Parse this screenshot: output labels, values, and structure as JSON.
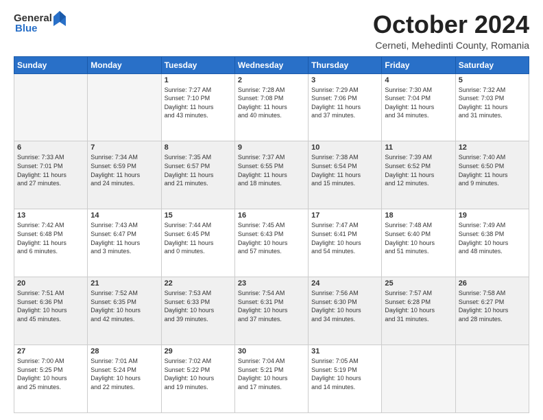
{
  "logo": {
    "general": "General",
    "blue": "Blue"
  },
  "header": {
    "month": "October 2024",
    "location": "Cerneti, Mehedinti County, Romania"
  },
  "weekdays": [
    "Sunday",
    "Monday",
    "Tuesday",
    "Wednesday",
    "Thursday",
    "Friday",
    "Saturday"
  ],
  "weeks": [
    [
      {
        "day": "",
        "detail": ""
      },
      {
        "day": "",
        "detail": ""
      },
      {
        "day": "1",
        "detail": "Sunrise: 7:27 AM\nSunset: 7:10 PM\nDaylight: 11 hours\nand 43 minutes."
      },
      {
        "day": "2",
        "detail": "Sunrise: 7:28 AM\nSunset: 7:08 PM\nDaylight: 11 hours\nand 40 minutes."
      },
      {
        "day": "3",
        "detail": "Sunrise: 7:29 AM\nSunset: 7:06 PM\nDaylight: 11 hours\nand 37 minutes."
      },
      {
        "day": "4",
        "detail": "Sunrise: 7:30 AM\nSunset: 7:04 PM\nDaylight: 11 hours\nand 34 minutes."
      },
      {
        "day": "5",
        "detail": "Sunrise: 7:32 AM\nSunset: 7:03 PM\nDaylight: 11 hours\nand 31 minutes."
      }
    ],
    [
      {
        "day": "6",
        "detail": "Sunrise: 7:33 AM\nSunset: 7:01 PM\nDaylight: 11 hours\nand 27 minutes."
      },
      {
        "day": "7",
        "detail": "Sunrise: 7:34 AM\nSunset: 6:59 PM\nDaylight: 11 hours\nand 24 minutes."
      },
      {
        "day": "8",
        "detail": "Sunrise: 7:35 AM\nSunset: 6:57 PM\nDaylight: 11 hours\nand 21 minutes."
      },
      {
        "day": "9",
        "detail": "Sunrise: 7:37 AM\nSunset: 6:55 PM\nDaylight: 11 hours\nand 18 minutes."
      },
      {
        "day": "10",
        "detail": "Sunrise: 7:38 AM\nSunset: 6:54 PM\nDaylight: 11 hours\nand 15 minutes."
      },
      {
        "day": "11",
        "detail": "Sunrise: 7:39 AM\nSunset: 6:52 PM\nDaylight: 11 hours\nand 12 minutes."
      },
      {
        "day": "12",
        "detail": "Sunrise: 7:40 AM\nSunset: 6:50 PM\nDaylight: 11 hours\nand 9 minutes."
      }
    ],
    [
      {
        "day": "13",
        "detail": "Sunrise: 7:42 AM\nSunset: 6:48 PM\nDaylight: 11 hours\nand 6 minutes."
      },
      {
        "day": "14",
        "detail": "Sunrise: 7:43 AM\nSunset: 6:47 PM\nDaylight: 11 hours\nand 3 minutes."
      },
      {
        "day": "15",
        "detail": "Sunrise: 7:44 AM\nSunset: 6:45 PM\nDaylight: 11 hours\nand 0 minutes."
      },
      {
        "day": "16",
        "detail": "Sunrise: 7:45 AM\nSunset: 6:43 PM\nDaylight: 10 hours\nand 57 minutes."
      },
      {
        "day": "17",
        "detail": "Sunrise: 7:47 AM\nSunset: 6:41 PM\nDaylight: 10 hours\nand 54 minutes."
      },
      {
        "day": "18",
        "detail": "Sunrise: 7:48 AM\nSunset: 6:40 PM\nDaylight: 10 hours\nand 51 minutes."
      },
      {
        "day": "19",
        "detail": "Sunrise: 7:49 AM\nSunset: 6:38 PM\nDaylight: 10 hours\nand 48 minutes."
      }
    ],
    [
      {
        "day": "20",
        "detail": "Sunrise: 7:51 AM\nSunset: 6:36 PM\nDaylight: 10 hours\nand 45 minutes."
      },
      {
        "day": "21",
        "detail": "Sunrise: 7:52 AM\nSunset: 6:35 PM\nDaylight: 10 hours\nand 42 minutes."
      },
      {
        "day": "22",
        "detail": "Sunrise: 7:53 AM\nSunset: 6:33 PM\nDaylight: 10 hours\nand 39 minutes."
      },
      {
        "day": "23",
        "detail": "Sunrise: 7:54 AM\nSunset: 6:31 PM\nDaylight: 10 hours\nand 37 minutes."
      },
      {
        "day": "24",
        "detail": "Sunrise: 7:56 AM\nSunset: 6:30 PM\nDaylight: 10 hours\nand 34 minutes."
      },
      {
        "day": "25",
        "detail": "Sunrise: 7:57 AM\nSunset: 6:28 PM\nDaylight: 10 hours\nand 31 minutes."
      },
      {
        "day": "26",
        "detail": "Sunrise: 7:58 AM\nSunset: 6:27 PM\nDaylight: 10 hours\nand 28 minutes."
      }
    ],
    [
      {
        "day": "27",
        "detail": "Sunrise: 7:00 AM\nSunset: 5:25 PM\nDaylight: 10 hours\nand 25 minutes."
      },
      {
        "day": "28",
        "detail": "Sunrise: 7:01 AM\nSunset: 5:24 PM\nDaylight: 10 hours\nand 22 minutes."
      },
      {
        "day": "29",
        "detail": "Sunrise: 7:02 AM\nSunset: 5:22 PM\nDaylight: 10 hours\nand 19 minutes."
      },
      {
        "day": "30",
        "detail": "Sunrise: 7:04 AM\nSunset: 5:21 PM\nDaylight: 10 hours\nand 17 minutes."
      },
      {
        "day": "31",
        "detail": "Sunrise: 7:05 AM\nSunset: 5:19 PM\nDaylight: 10 hours\nand 14 minutes."
      },
      {
        "day": "",
        "detail": ""
      },
      {
        "day": "",
        "detail": ""
      }
    ]
  ]
}
